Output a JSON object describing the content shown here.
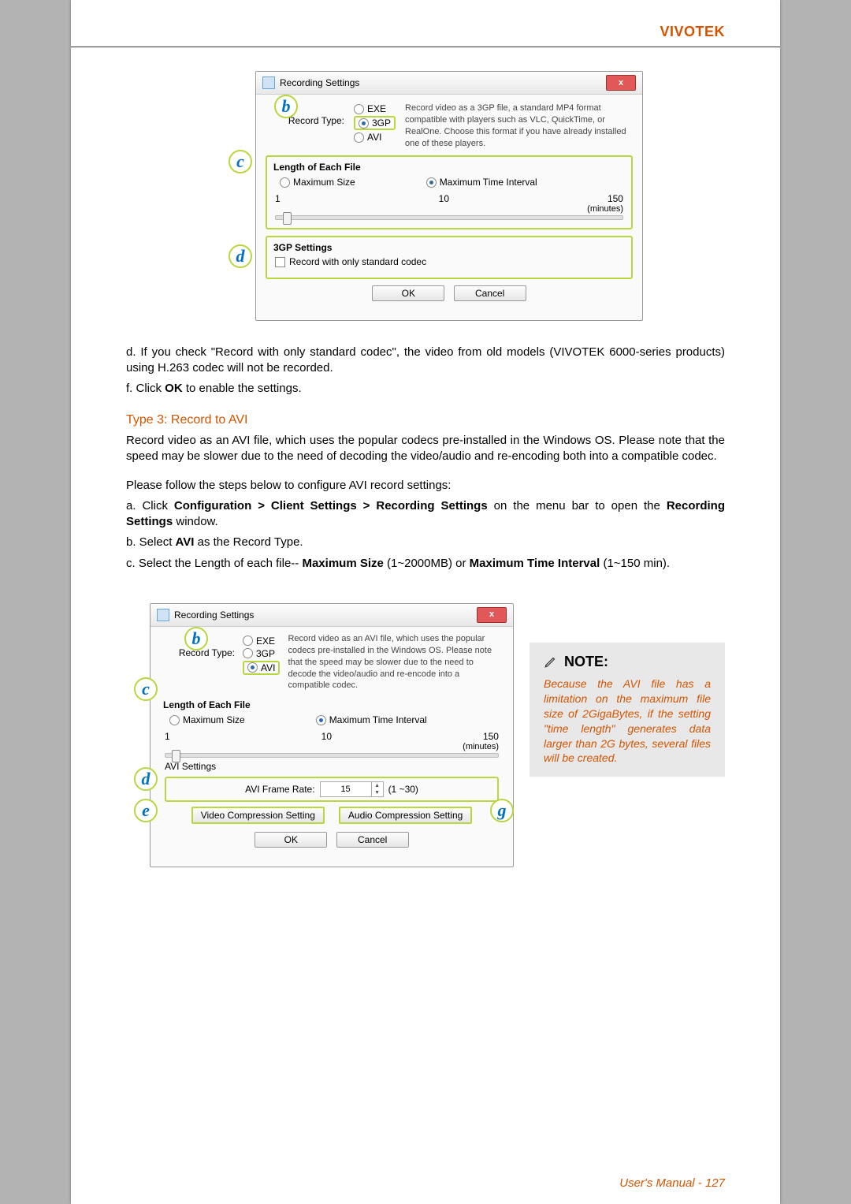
{
  "header": {
    "brand": "VIVOTEK"
  },
  "dialog1": {
    "title": "Recording Settings",
    "close": "x",
    "record_type_label": "Record Type:",
    "opt_exe": "EXE",
    "opt_3gp": "3GP",
    "opt_avi": "AVI",
    "desc": "Record video as a 3GP file, a standard MP4 format compatible with players such as VLC, QuickTime, or RealOne. Choose this format if you have already installed one of these players.",
    "length_title": "Length of Each File",
    "max_size": "Maximum Size",
    "max_time": "Maximum Time Interval",
    "m1": "1",
    "m2": "10",
    "m3": "150",
    "unit": "(minutes)",
    "gp_title": "3GP Settings",
    "gp_check": "Record with only standard codec",
    "ok": "OK",
    "cancel": "Cancel"
  },
  "body": {
    "d": "d. If you check \"Record with only standard codec\", the video from old models (VIVOTEK 6000-series products) using H.263 codec will not be recorded.",
    "f": "f. Click ",
    "f_bold": "OK",
    "f_after": " to enable the settings.",
    "type3_title": "Type 3: Record to AVI",
    "type3_p1": "Record video as an AVI file, which uses the popular codecs pre-installed in the Windows OS. Please note that the speed may be slower due to the need of decoding the video/audio and re-encoding both into a compatible codec.",
    "type3_p2": "Please follow the steps below to configure AVI record settings:",
    "a1": "a. Click ",
    "a1_bold": "Configuration > Client Settings > Recording Settings",
    "a1_mid": " on the menu bar to open the ",
    "a1_bold2": "Recording Settings",
    "a1_end": " window.",
    "b1": "b. Select ",
    "b1_bold": "AVI",
    "b1_end": " as the Record Type.",
    "c1": "c. Select the Length of each file-- ",
    "c1_bold": "Maximum Size",
    "c1_mid": " (1~2000MB) or ",
    "c1_bold2": "Maximum Time Interval",
    "c1_end": " (1~150 min)."
  },
  "dialog2": {
    "title": "Recording Settings",
    "close": "x",
    "record_type_label": "Record Type:",
    "opt_exe": "EXE",
    "opt_3gp": "3GP",
    "opt_avi": "AVI",
    "desc": "Record video as an AVI file, which uses the popular codecs pre-installed in the Windows OS. Please note that the speed may be slower due to the need to decode the video/audio and re-encode into a compatible codec.",
    "length_title": "Length of Each File",
    "max_size": "Maximum Size",
    "max_time": "Maximum Time Interval",
    "m1": "1",
    "m2": "10",
    "m3": "150",
    "unit": "(minutes)",
    "avi_title": "AVI Settings",
    "frame_rate_label": "AVI Frame Rate:",
    "frame_rate_val": "15",
    "frame_rate_range": "(1 ~30)",
    "vcomp": "Video Compression Setting",
    "acomp": "Audio Compression Setting",
    "ok": "OK",
    "cancel": "Cancel"
  },
  "note": {
    "title": "NOTE:",
    "text": "Because the AVI file has a limitation on the maximum file size of 2GigaBytes, if the setting \"time length\" generates data larger than 2G bytes, several files will be created."
  },
  "callouts": {
    "b": "b",
    "c": "c",
    "d": "d",
    "e": "e",
    "g": "g"
  },
  "footer": {
    "label": "User's Manual - ",
    "page": "127"
  }
}
